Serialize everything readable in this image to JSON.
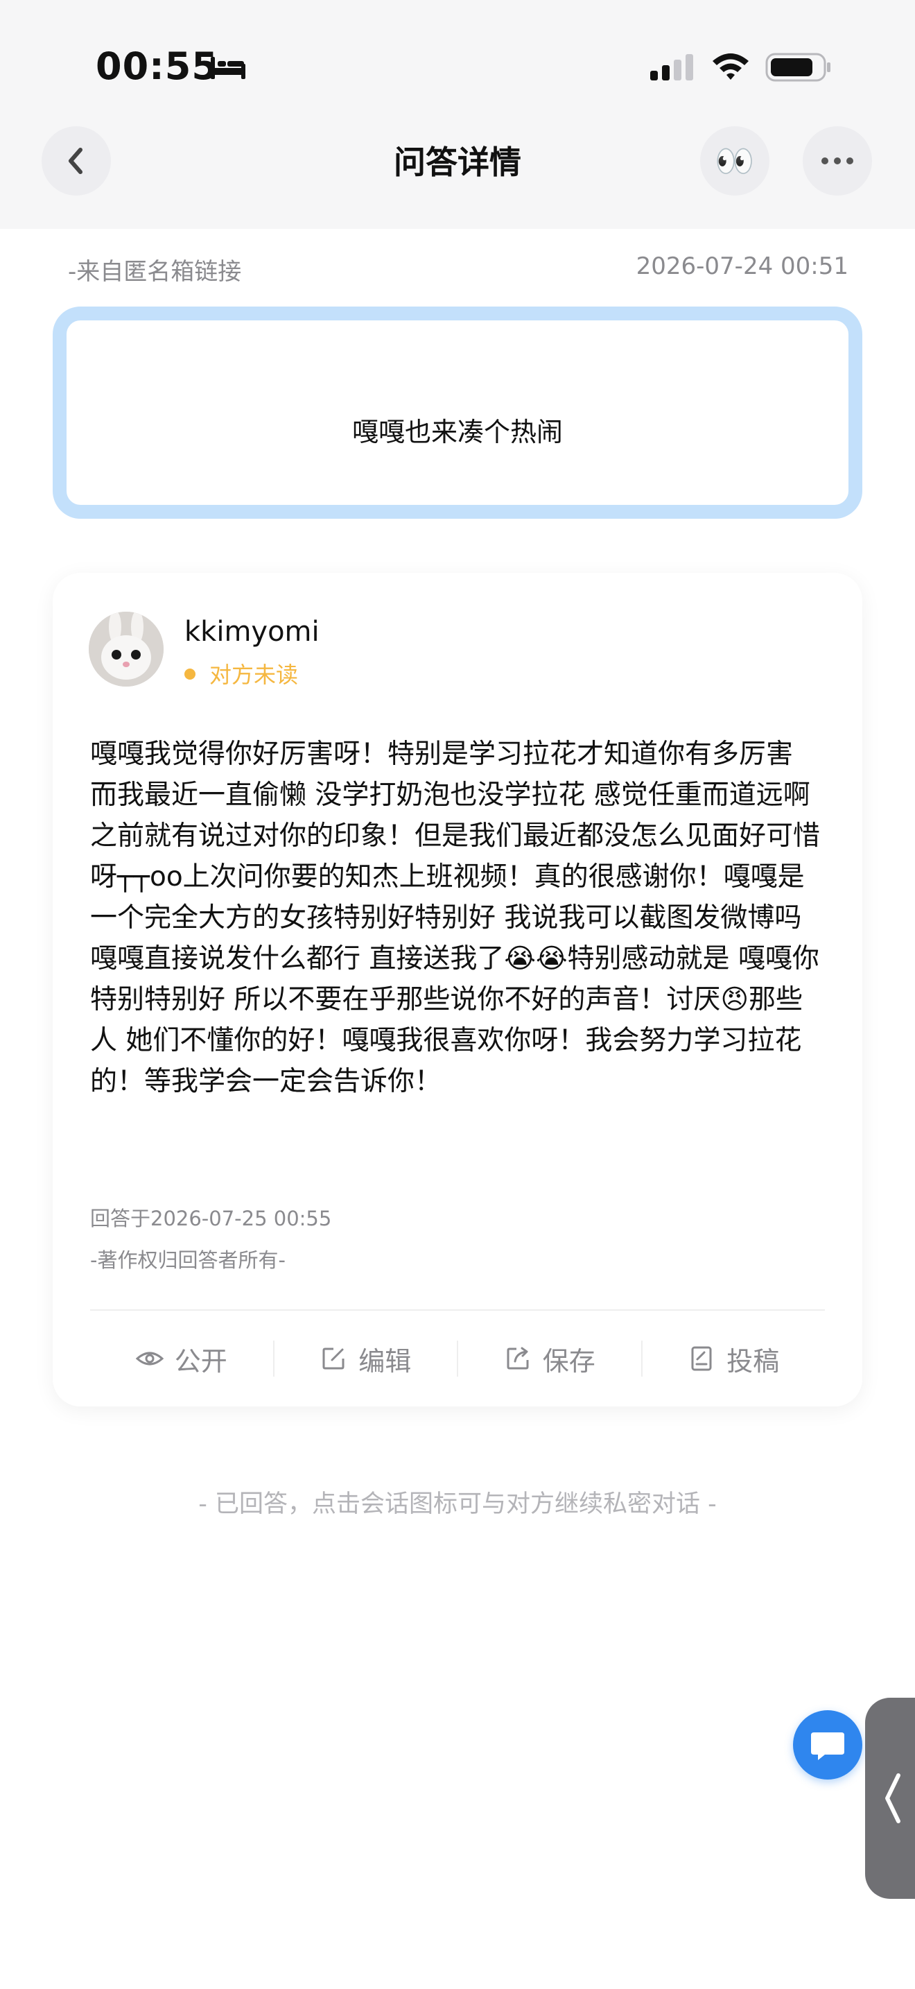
{
  "status_bar": {
    "time": "00:55",
    "icons": [
      "bed-icon",
      "signal-icon",
      "wifi-icon",
      "battery-icon"
    ]
  },
  "nav": {
    "title": "问答详情",
    "eyes_emoji": "👀",
    "icons": [
      "back-chevron-icon",
      "eyes-icon",
      "more-icon"
    ]
  },
  "question": {
    "source": "-来自匿名箱链接",
    "time": "2026-07-24 00:51",
    "text": "嘎嘎也来凑个热闹"
  },
  "answer": {
    "username": "kkimyomi",
    "read_status": "对方未读",
    "text": "嘎嘎我觉得你好厉害呀！特别是学习拉花才知道你有多厉害 而我最近一直偷懒 没学打奶泡也没学拉花 感觉任重而道远啊 之前就有说过对你的印象！但是我们最近都没怎么见面好可惜呀┬┬oo上次问你要的知杰上班视频！真的很感谢你！嘎嘎是一个完全大方的女孩特别好特别好 我说我可以截图发微博吗 嘎嘎直接说发什么都行 直接送我了😭😭特别感动就是 嘎嘎你特别特别好 所以不要在乎那些说你不好的声音！讨厌😠那些人 她们不懂你的好！嘎嘎我很喜欢你呀！我会努力学习拉花的！等我学会一定会告诉你！",
    "answered_at": "回答于2026-07-25 00:55",
    "copyright": "-著作权归回答者所有-"
  },
  "actions": {
    "public": "公开",
    "edit": "编辑",
    "save": "保存",
    "submit": "投稿"
  },
  "footer": {
    "hint": "- 已回答，点击会话图标可与对方继续私密对话 -"
  },
  "colors": {
    "accent_blue": "#2f86ee",
    "question_border": "#c3e0fb",
    "unread_orange": "#f5b740",
    "muted_gray": "#8a8a8e",
    "nav_bg": "#f6f6f7"
  }
}
